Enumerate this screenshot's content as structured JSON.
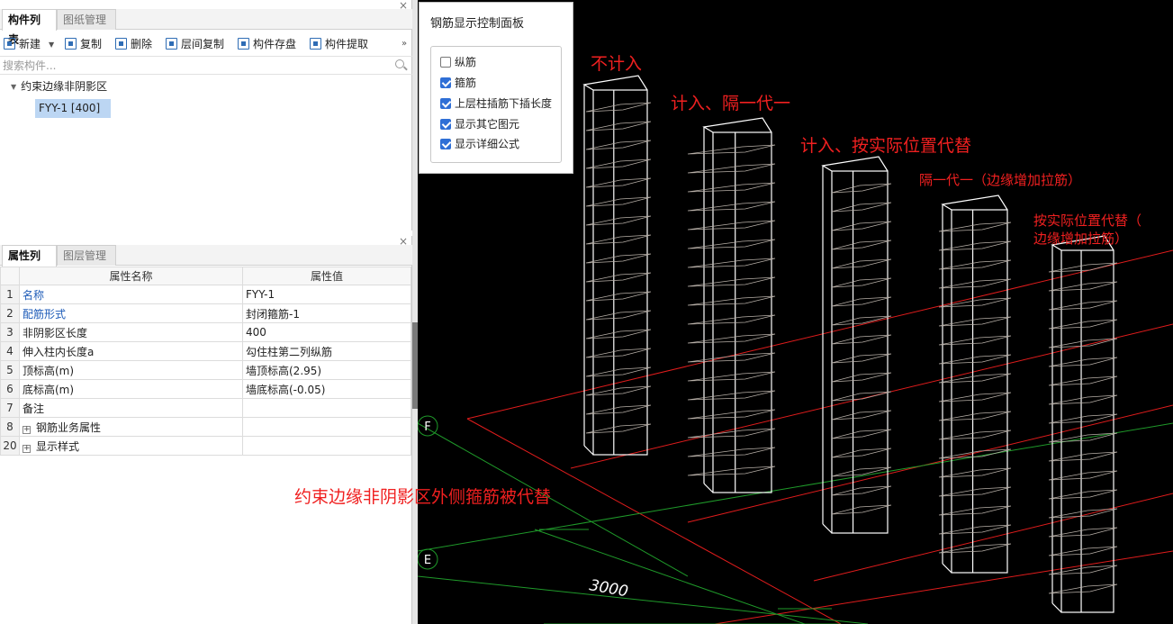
{
  "component_panel": {
    "tabs": [
      "构件列表",
      "图纸管理"
    ],
    "close": "×",
    "toolbar": {
      "new": "新建",
      "copy": "复制",
      "delete": "删除",
      "floor_copy": "层间复制",
      "save": "构件存盘",
      "extract": "构件提取",
      "more": "»"
    },
    "search_placeholder": "搜索构件...",
    "tree_root": "约束边缘非阴影区",
    "tree_item": "FYY-1 [400]"
  },
  "property_panel": {
    "tabs": [
      "属性列表",
      "图层管理"
    ],
    "close": "×",
    "headers": [
      "属性名称",
      "属性值"
    ],
    "rows": [
      {
        "n": "1",
        "name": "名称",
        "value": "FYY-1"
      },
      {
        "n": "2",
        "name": "配筋形式",
        "value": "封闭箍筋-1"
      },
      {
        "n": "3",
        "name": "非阴影区长度",
        "value": "400"
      },
      {
        "n": "4",
        "name": "伸入柱内长度a",
        "value": "勾住柱第二列纵筋"
      },
      {
        "n": "5",
        "name": "顶标高(m)",
        "value": "墙顶标高(2.95)"
      },
      {
        "n": "6",
        "name": "底标高(m)",
        "value": "墙底标高(-0.05)"
      },
      {
        "n": "7",
        "name": "备注",
        "value": ""
      },
      {
        "n": "8",
        "name": "钢筋业务属性",
        "value": ""
      },
      {
        "n": "20",
        "name": "显示样式",
        "value": ""
      }
    ]
  },
  "rebar_panel": {
    "title": "钢筋显示控制面板",
    "options": [
      {
        "label": "纵筋",
        "checked": false
      },
      {
        "label": "箍筋",
        "checked": true
      },
      {
        "label": "上层柱插筋下插长度",
        "checked": true
      },
      {
        "label": "显示其它图元",
        "checked": true
      },
      {
        "label": "显示详细公式",
        "checked": true
      }
    ]
  },
  "annotations": {
    "a1": "不计入",
    "a2": "计入、隔一代一",
    "a3": "计入、按实际位置代替",
    "a4": "隔一代一（边缘增加拉筋）",
    "a5_line1": "按实际位置代替（",
    "a5_line2": "边缘增加拉筋）",
    "bottom": "约束边缘非阴影区外侧箍筋被代替"
  },
  "view3d": {
    "axis_F": "F",
    "axis_E": "E",
    "dimension": "3000",
    "colors": {
      "background": "#000000",
      "grid_red": "#e01c1c",
      "grid_green": "#1f9a2a",
      "column": "#ffffff",
      "rebar": "#b8b0a8",
      "annotation": "#f02020"
    }
  }
}
